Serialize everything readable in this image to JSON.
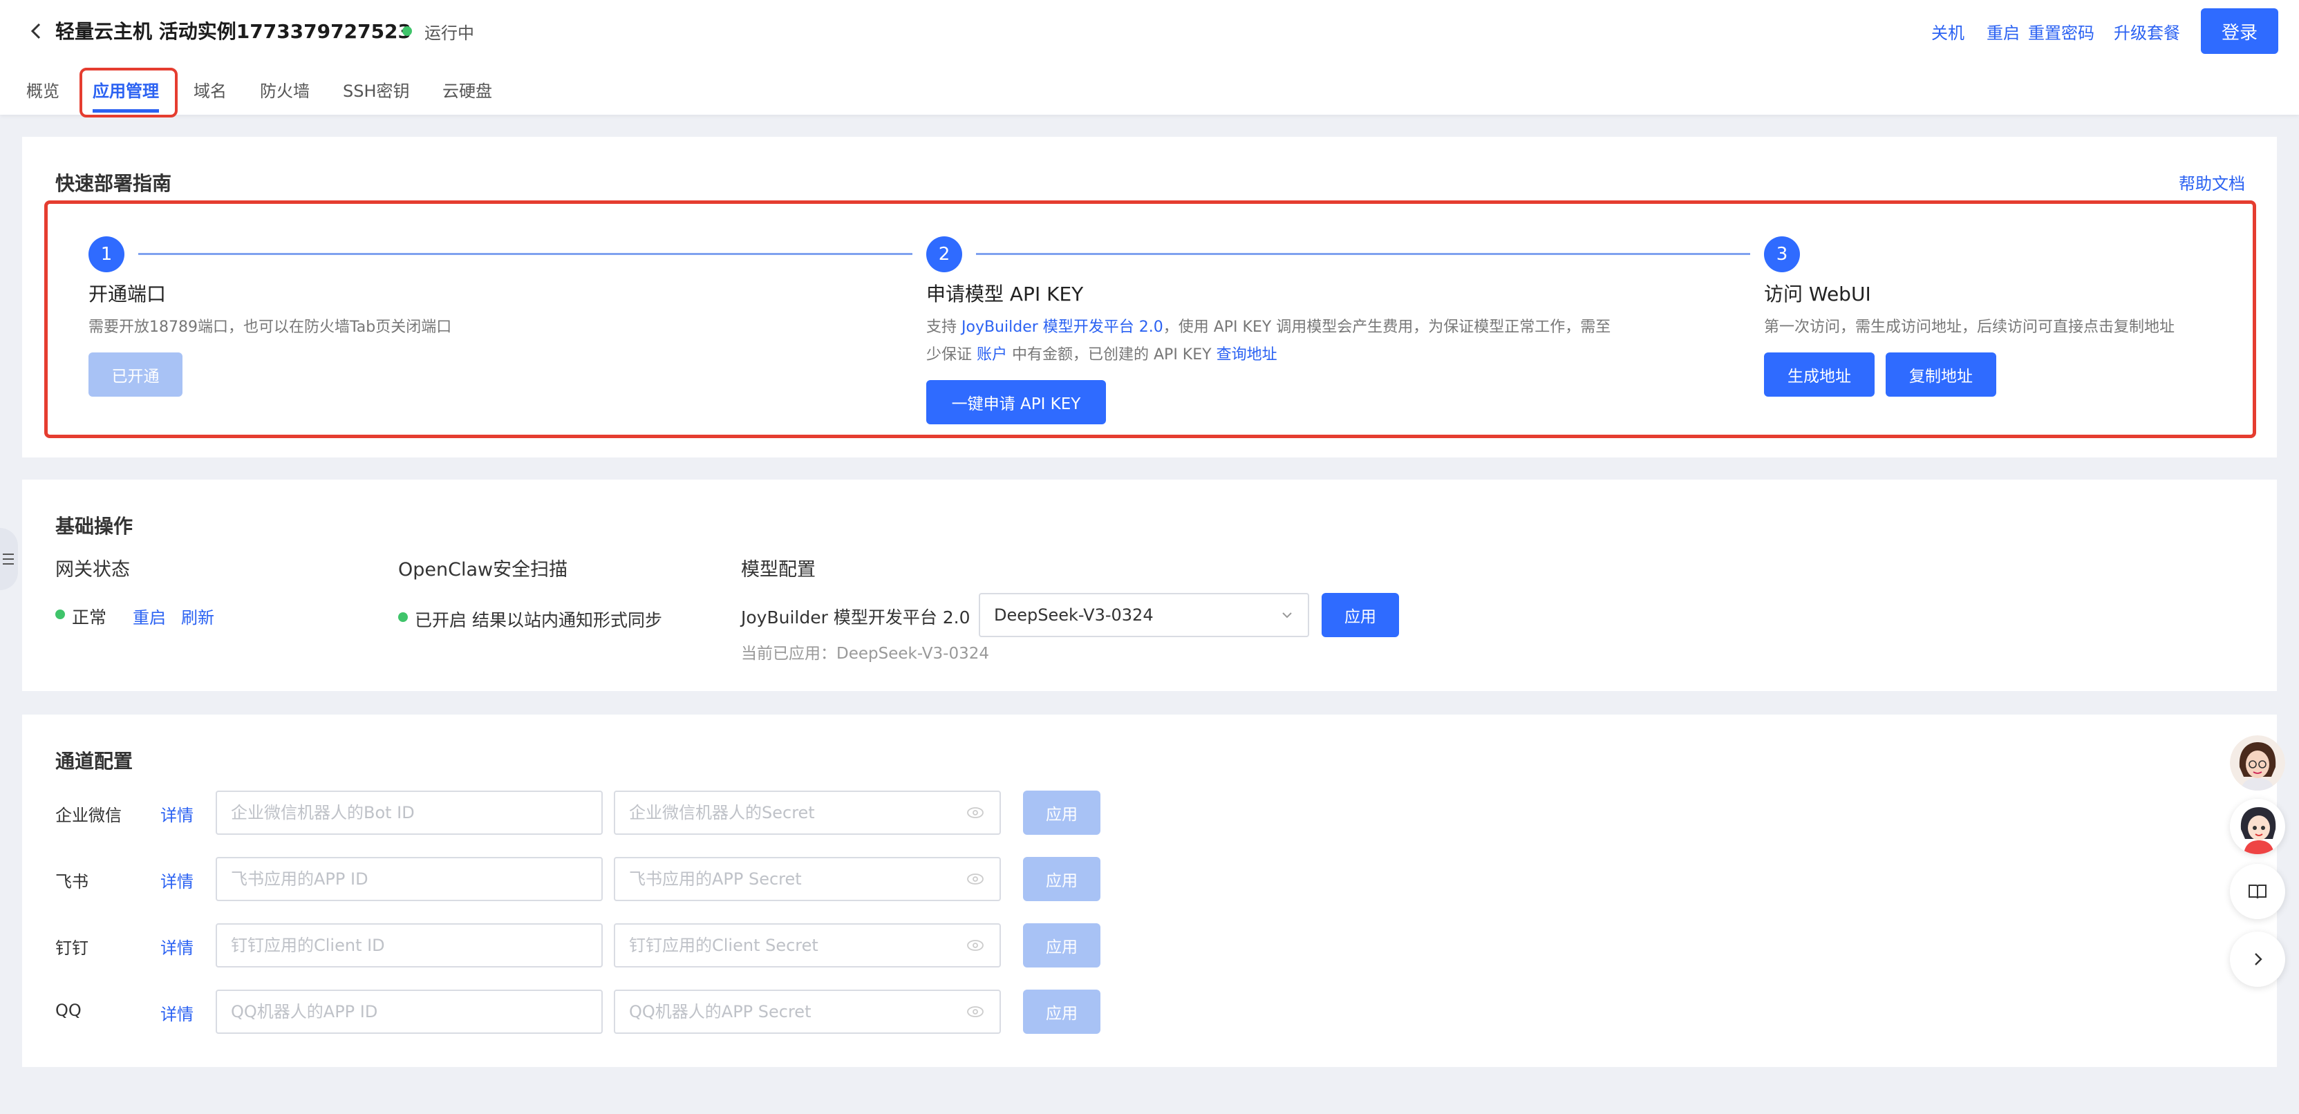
{
  "header": {
    "title": "轻量云主机 活动实例1773379727523",
    "status": "运行中",
    "actions": [
      "关机",
      "重启",
      "重置密码",
      "升级套餐"
    ],
    "login": "登录"
  },
  "tabs": [
    "概览",
    "应用管理",
    "域名",
    "防火墙",
    "SSH密钥",
    "云硬盘"
  ],
  "guide": {
    "title": "快速部署指南",
    "help_link": "帮助文档",
    "step1": {
      "num": "1",
      "title": "开通端口",
      "desc": "需要开放18789端口，也可以在防火墙Tab页关闭端口",
      "button": "已开通"
    },
    "step2": {
      "num": "2",
      "title": "申请模型 API KEY",
      "desc_a": "支持 ",
      "desc_link1": "JoyBuilder 模型开发平台 2.0",
      "desc_b": "，使用 API KEY 调用模型会产生费用，为保证模型正常工作，需至",
      "desc_c": "少保证 ",
      "desc_link2": "账户",
      "desc_d": " 中有金额，已创建的 API KEY ",
      "desc_link3": "查询地址",
      "button": "一键申请 API KEY"
    },
    "step3": {
      "num": "3",
      "title": "访问 WebUI",
      "desc": "第一次访问，需生成访问地址，后续访问可直接点击复制地址",
      "button_generate": "生成地址",
      "button_copy": "复制地址"
    }
  },
  "basic": {
    "title": "基础操作",
    "gateway": {
      "label": "网关状态",
      "status": "正常",
      "restart": "重启",
      "refresh": "刷新"
    },
    "scan": {
      "label": "OpenClaw安全扫描",
      "status": "已开启 结果以站内通知形式同步"
    },
    "model": {
      "label": "模型配置",
      "platform": "JoyBuilder 模型开发平台 2.0",
      "selected": "DeepSeek-V3-0324",
      "apply": "应用",
      "current": "当前已应用：DeepSeek-V3-0324"
    }
  },
  "channels": {
    "title": "通道配置",
    "detail_label": "详情",
    "apply_label": "应用",
    "rows": [
      {
        "name": "企业微信",
        "id_placeholder": "企业微信机器人的Bot ID",
        "secret_placeholder": "企业微信机器人的Secret"
      },
      {
        "name": "飞书",
        "id_placeholder": "飞书应用的APP ID",
        "secret_placeholder": "飞书应用的APP Secret"
      },
      {
        "name": "钉钉",
        "id_placeholder": "钉钉应用的Client ID",
        "secret_placeholder": "钉钉应用的Client Secret"
      },
      {
        "name": "QQ",
        "id_placeholder": "QQ机器人的APP ID",
        "secret_placeholder": "QQ机器人的APP Secret"
      }
    ]
  },
  "sidebar_icons": [
    "assistant-avatar",
    "assistant-avatar-2",
    "book-icon",
    "chevron-right-icon"
  ]
}
